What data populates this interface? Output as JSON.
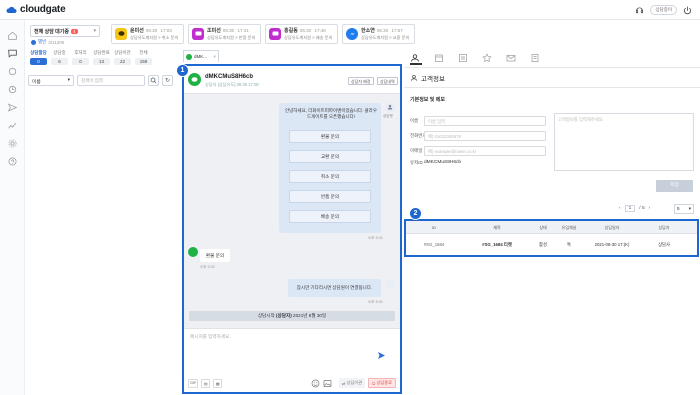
{
  "brand": {
    "name": "cloudgate"
  },
  "topbar": {
    "status_label": "상담중이"
  },
  "queue": {
    "label": "전체 상담 대기중",
    "count": "4",
    "agent_label": "별빈",
    "agent_time": "3/11200"
  },
  "notifications": [
    {
      "name": "윤미선",
      "time": "06:30",
      "time2": "17:03",
      "sub": "상담유도계지원 > 취소 문의",
      "color": "#f5c518",
      "icon": "talk-icon"
    },
    {
      "name": "조미선",
      "time": "06:30",
      "time2": "17:41",
      "sub": "상담유도계지원 > 반품 문의",
      "color": "#c02ed0",
      "icon": "chat-icon"
    },
    {
      "name": "홍길동",
      "time": "06:30",
      "time2": "17:46",
      "sub": "상담유도계지원 > 배송 문의",
      "color": "#c02ed0",
      "icon": "chat-icon"
    },
    {
      "name": "한소연",
      "time": "06:30",
      "time2": "17:57",
      "sub": "상담유도계지원 > 교환 문의",
      "color": "#1e7bf0",
      "icon": "messenger-icon"
    }
  ],
  "stats": [
    {
      "label": "상담할당",
      "value": "0",
      "active": true
    },
    {
      "label": "상담중",
      "value": "6",
      "active": false
    },
    {
      "label": "후처리",
      "value": "0",
      "active": false
    },
    {
      "label": "상담완료",
      "value": "13",
      "active": false
    },
    {
      "label": "상담이관",
      "value": "22",
      "active": false
    },
    {
      "label": "전체",
      "value": "159",
      "active": false
    }
  ],
  "filter": {
    "select_value": "이름",
    "search_placeholder": "검색어 입력"
  },
  "chat_tab": {
    "label": "dMK..."
  },
  "chat": {
    "customer_name": "dMKCMuS8H6cb",
    "customer_sub": "상담유 [상담유도] 06:30 17:00",
    "btn_transfer": "상담자 배정",
    "btn_info": "상담내역",
    "bot_message": "안녕하세요, 더화이트피파이벤이었습니다. 클라우드게이트를 오픈했습니다!",
    "options": [
      "환불 문의",
      "교환 문의",
      "취소 문의",
      "반품 문의",
      "배송 문의"
    ],
    "bot_label": "상담봇",
    "bot_time": "오후 5:30",
    "customer_message": "환불 문의",
    "customer_time": "오후 5:30",
    "system_message": "잠시만 기다리시면 상담원이 연결됩니다.",
    "system_time": "오후 5:30",
    "start_prefix": "상담시작",
    "start_agent": "(상담자)",
    "start_date": "2021년 8월 30일",
    "input_placeholder": "메시지를 입력하세요.",
    "hold_label": "상담이관",
    "end_label": "상담종료",
    "tool_labels": [
      "GIF"
    ]
  },
  "badges": {
    "chat": "1",
    "table": "2"
  },
  "customer": {
    "section_title": "고객정보",
    "subsection": "기본정보 및 메모",
    "fields": [
      {
        "label": "이름",
        "placeholder": "이름 입력"
      },
      {
        "label": "전화번호",
        "placeholder": "예) 01012345678"
      },
      {
        "label": "이메일",
        "placeholder": "예) example@naver.co.kr"
      }
    ],
    "id_label": "유저ID",
    "id_value": "dMKCMuS8H6cb",
    "memo_placeholder": "고객정보를 입력해주세요",
    "save_label": "저장"
  },
  "pager": {
    "current": "1",
    "total": "/ 5",
    "page_size": "5"
  },
  "table": {
    "headers": [
      "ID",
      "제목",
      "상태",
      "유입채널",
      "상담일자",
      "상담자"
    ],
    "rows": [
      [
        "#SG_1684",
        "#SG_1684 티켓",
        "활성",
        "톡",
        "2021-08-30 17:(K)",
        "상담사"
      ]
    ]
  }
}
